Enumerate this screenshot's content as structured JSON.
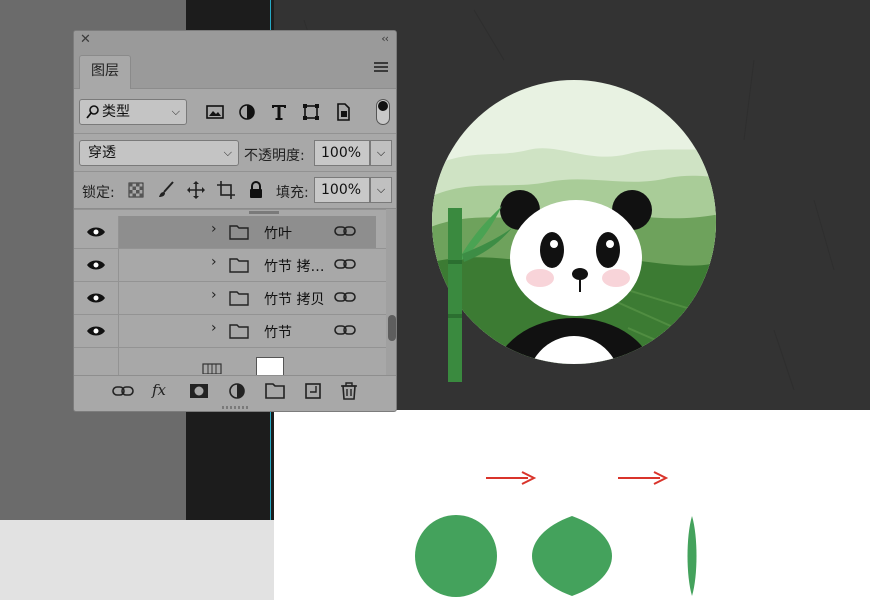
{
  "layers_panel": {
    "close_glyph": "✕",
    "collapse_glyph": "‹‹",
    "tab_label": "图层",
    "filter": {
      "label": "类型",
      "icon": "search-icon"
    },
    "filter_icons": [
      "image-filter-icon",
      "adjustment-filter-icon",
      "type-filter-icon",
      "shape-filter-icon",
      "smart-object-filter-icon"
    ],
    "blend_mode": "穿透",
    "opacity_label": "不透明度:",
    "opacity_value": "100%",
    "lock_label": "锁定:",
    "lock_icons": [
      "lock-transparent-icon",
      "lock-paint-icon",
      "lock-move-icon",
      "lock-artboard-icon",
      "lock-all-icon"
    ],
    "fill_label": "填充:",
    "fill_value": "100%",
    "layers": [
      {
        "name": "竹叶",
        "selected": true
      },
      {
        "name": "竹节 拷…",
        "selected": false
      },
      {
        "name": "竹节 拷贝",
        "selected": false
      },
      {
        "name": "竹节",
        "selected": false
      }
    ],
    "bottom_icons": [
      "link-layers-icon",
      "fx-icon",
      "add-mask-icon",
      "adjustment-layer-icon",
      "new-group-icon",
      "new-layer-icon",
      "delete-icon"
    ],
    "fx_label": "fx"
  },
  "canvas": {
    "background_dark": "#333333",
    "background_white": "#ffffff",
    "panda_scene": {
      "sky_color": "#e8f2e2",
      "hill_colors": [
        "#cfe3c4",
        "#a9cc98",
        "#6ea25c",
        "#3c7b33"
      ]
    },
    "bamboo_color": "#3a8a3f",
    "leaf_shape_color": "#44a25c",
    "arrow_color": "#d9342b"
  }
}
